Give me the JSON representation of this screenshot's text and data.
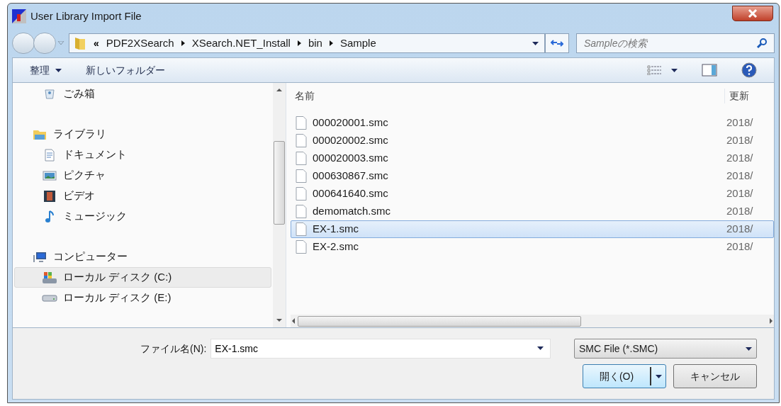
{
  "window": {
    "title": "User Library Import File"
  },
  "address_bar": {
    "overflow": "«",
    "crumbs": [
      "PDF2XSearch",
      "XSearch.NET_Install",
      "bin",
      "Sample"
    ]
  },
  "search": {
    "placeholder": "Sampleの検索"
  },
  "toolbar": {
    "organize": "整理",
    "new_folder": "新しいフォルダー"
  },
  "sidebar": {
    "items": [
      {
        "label": "ごみ箱",
        "kind": "trash",
        "selected": false
      },
      {
        "label": "ライブラリ",
        "kind": "library",
        "selected": false,
        "children": [
          {
            "label": "ドキュメント",
            "kind": "document",
            "selected": false
          },
          {
            "label": "ピクチャ",
            "kind": "picture",
            "selected": false
          },
          {
            "label": "ビデオ",
            "kind": "video",
            "selected": false
          },
          {
            "label": "ミュージック",
            "kind": "music",
            "selected": false
          }
        ]
      },
      {
        "label": "コンピューター",
        "kind": "computer",
        "selected": false,
        "children": [
          {
            "label": "ローカル ディスク (C:)",
            "kind": "system_drive",
            "selected": true
          },
          {
            "label": "ローカル ディスク (E:)",
            "kind": "drive",
            "selected": false
          }
        ]
      }
    ]
  },
  "table": {
    "columns": [
      "名前",
      "更新"
    ],
    "rows": [
      {
        "name": "000020001.smc",
        "date": "2018/",
        "selected": false
      },
      {
        "name": "000020002.smc",
        "date": "2018/",
        "selected": false
      },
      {
        "name": "000020003.smc",
        "date": "2018/",
        "selected": false
      },
      {
        "name": "000630867.smc",
        "date": "2018/",
        "selected": false
      },
      {
        "name": "000641640.smc",
        "date": "2018/",
        "selected": false
      },
      {
        "name": "demomatch.smc",
        "date": "2018/",
        "selected": false
      },
      {
        "name": "EX-1.smc",
        "date": "2018/",
        "selected": true
      },
      {
        "name": "EX-2.smc",
        "date": "2018/",
        "selected": false
      }
    ]
  },
  "file_name": {
    "label": "ファイル名(N):",
    "value": "EX-1.smc"
  },
  "file_type": {
    "value": "SMC File (*.SMC)"
  },
  "buttons": {
    "open": "開く(O)",
    "cancel": "キャンセル"
  }
}
